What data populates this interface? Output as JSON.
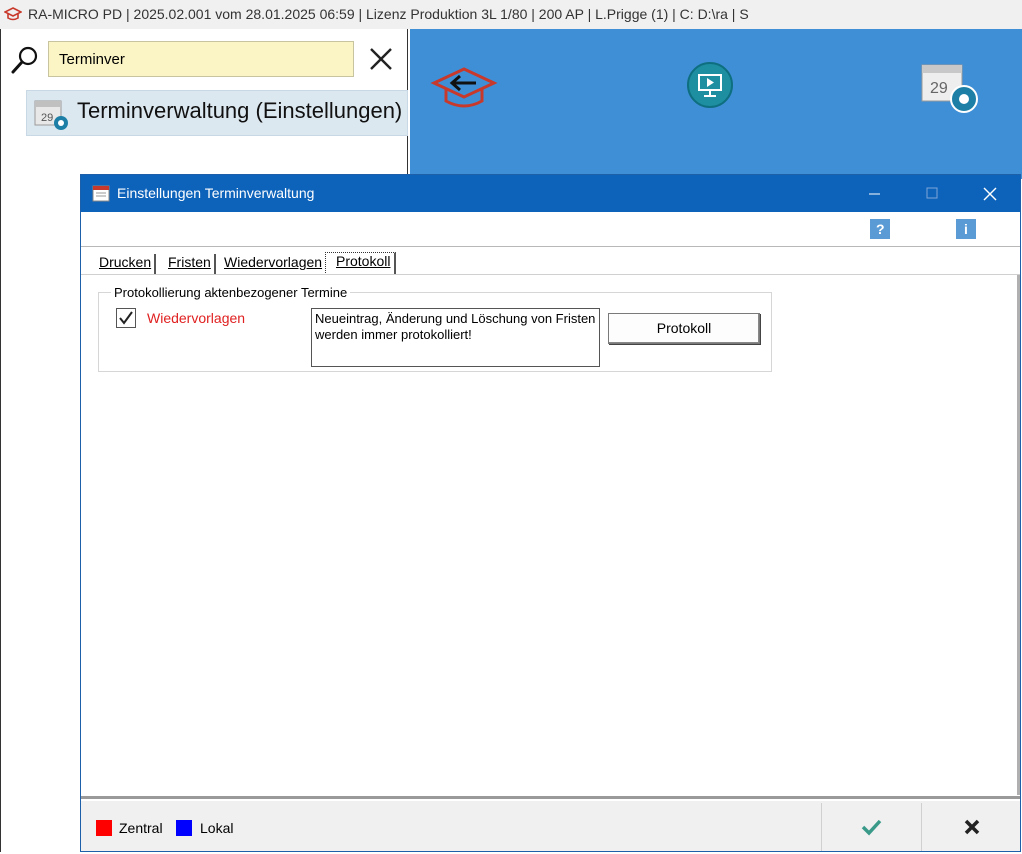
{
  "app": {
    "title": "RA-MICRO PD | 2025.02.001 vom 28.01.2025 06:59  | Lizenz Produktion 3L  1/80 | 200 AP | L.Prigge (1) | C: D:\\ra | S",
    "icon": "mortarboard-icon",
    "accent": "#c8392b"
  },
  "search": {
    "value": "Terminver",
    "result_label": "Terminverwaltung (Einstellungen)",
    "result_calendar_day": "29",
    "field_color": "#fbf5c6"
  },
  "ribbon": {
    "color": "#3f8fd6",
    "buttons": [
      "back-mortarboard-icon",
      "presentation-icon",
      "calendar-settings-icon"
    ],
    "calendar_day": "29"
  },
  "dialog": {
    "title": "Einstellungen Terminverwaltung",
    "titlebar_color": "#0d62ba",
    "help_icon": "?",
    "info_icon": "i",
    "tabs": [
      {
        "label": "Drucken",
        "selected": false
      },
      {
        "label": "Fristen",
        "selected": false
      },
      {
        "label": "Wiedervorlagen",
        "selected": false
      },
      {
        "label": "Protokoll",
        "selected": true
      }
    ],
    "group": {
      "title": "Protokollierung aktenbezogener Termine",
      "checkbox_label": "Wiedervorlagen",
      "checkbox_checked": true,
      "info_text": "Neueintrag, Änderung und Löschung von Fristen werden immer protokolliert!",
      "button_label": "Protokoll"
    },
    "legend": [
      {
        "label": "Zentral",
        "color": "#ff0000"
      },
      {
        "label": "Lokal",
        "color": "#0000ff"
      }
    ],
    "ok_icon": "checkmark-icon",
    "cancel_icon": "x-icon"
  }
}
